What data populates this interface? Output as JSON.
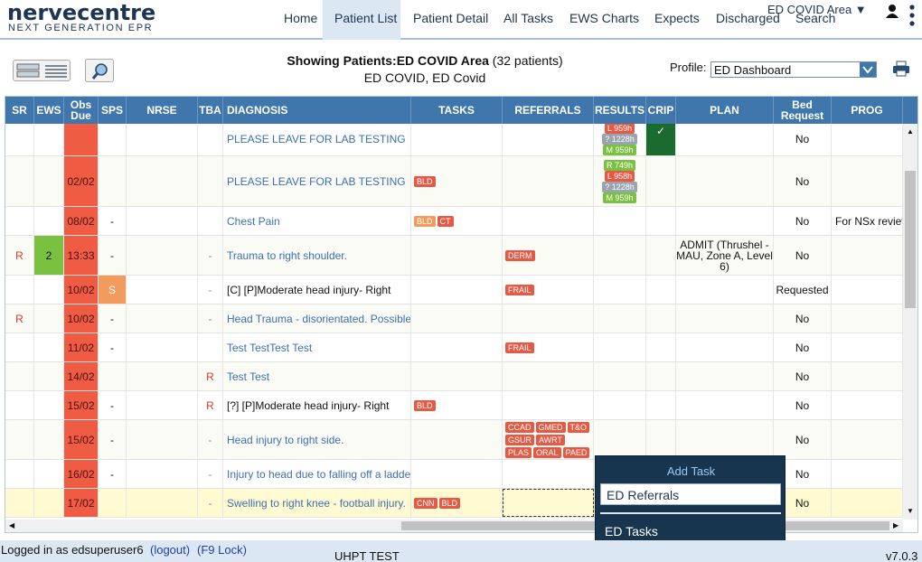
{
  "brand": {
    "name": "nervecentre",
    "tagline": "NEXT GENERATION EPR"
  },
  "nav": [
    "Home",
    "Patient List",
    "Patient Detail",
    "All Tasks",
    "EWS Charts",
    "Expects",
    "Discharged",
    "Search"
  ],
  "area": "ED COVID Area ▼",
  "header": {
    "showing_label": "Showing Patients:",
    "area_name": "ED COVID Area",
    "count": "(32 patients)",
    "subtitle": "ED COVID, ED Covid"
  },
  "profile": {
    "label": "Profile:",
    "value": "ED Dashboard"
  },
  "columns": [
    "SR",
    "EWS",
    "Obs Due",
    "SPS",
    "NRSE",
    "TBA",
    "DIAGNOSIS",
    "TASKS",
    "REFERRALS",
    "RESULTS",
    "CRIP",
    "PLAN",
    "Bed Request",
    "PROG"
  ],
  "rows": [
    {
      "sr": "",
      "ews": "",
      "obs": "",
      "sps": "",
      "tba": "",
      "diag": "PLEASE LEAVE FOR LAB TESTING",
      "tasks": [],
      "refs": [],
      "results": [
        "L 959h",
        "? 1228h",
        "M 959h"
      ],
      "crip": "✓",
      "plan": "",
      "bed": "No",
      "prog": ""
    },
    {
      "sr": "",
      "ews": "",
      "obs": "02/02",
      "sps": "",
      "tba": "",
      "diag": "PLEASE LEAVE FOR LAB TESTING",
      "tasks": [
        "BLD"
      ],
      "refs": [],
      "results": [
        "R 749h",
        "L 958h",
        "? 1228h",
        "M 959h"
      ],
      "crip": "",
      "plan": "",
      "bed": "No",
      "prog": ""
    },
    {
      "sr": "",
      "ews": "",
      "obs": "08/02",
      "sps": "-",
      "tba": "",
      "diag": "Chest Pain",
      "tasks": [
        "BLD",
        "CT"
      ],
      "refs": [],
      "results": [],
      "crip": "",
      "plan": "",
      "bed": "No",
      "prog": "For NSx review"
    },
    {
      "sr": "R",
      "ews": "2",
      "obs": "13:33",
      "sps": "-",
      "tba": "-",
      "diag": "Trauma to right shoulder.",
      "tasks": [],
      "refs": [
        "DERM"
      ],
      "results": [],
      "crip": "",
      "plan": "ADMIT (Thrushel - MAU, Zone A, Level 6)",
      "bed": "No",
      "prog": ""
    },
    {
      "sr": "",
      "ews": "",
      "obs": "10/02",
      "sps": "S",
      "tba": "-",
      "diag": "[C] [P]Moderate head injury- Right",
      "tasks": [],
      "refs": [
        "FRAIL"
      ],
      "results": [],
      "crip": "",
      "plan": "",
      "bed": "Requested",
      "prog": ""
    },
    {
      "sr": "R",
      "ews": "",
      "obs": "10/02",
      "sps": "-",
      "tba": "-",
      "diag": "Head Trauma - disorientated. Possible fracture",
      "tasks": [],
      "refs": [],
      "results": [],
      "crip": "",
      "plan": "",
      "bed": "No",
      "prog": ""
    },
    {
      "sr": "",
      "ews": "",
      "obs": "11/02",
      "sps": "-",
      "tba": "",
      "diag": "Test TestTest Test",
      "tasks": [],
      "refs": [
        "FRAIL"
      ],
      "results": [],
      "crip": "",
      "plan": "",
      "bed": "No",
      "prog": ""
    },
    {
      "sr": "",
      "ews": "",
      "obs": "14/02",
      "sps": "",
      "tba": "R",
      "diag": "Test Test",
      "tasks": [],
      "refs": [],
      "results": [],
      "crip": "",
      "plan": "",
      "bed": "No",
      "prog": ""
    },
    {
      "sr": "",
      "ews": "",
      "obs": "15/02",
      "sps": "-",
      "tba": "R",
      "diag": "[?] [P]Moderate head injury- Right",
      "tasks": [
        "BLD"
      ],
      "refs": [],
      "results": [],
      "crip": "",
      "plan": "",
      "bed": "No",
      "prog": ""
    },
    {
      "sr": "",
      "ews": "",
      "obs": "15/02",
      "sps": "-",
      "tba": "-",
      "diag": "Head injury to right side.",
      "tasks": [],
      "refs": [
        "CCAD",
        "GMED",
        "T&O",
        "GSUR",
        "AWRT",
        "PLAS",
        "ORAL",
        "PAED"
      ],
      "results": [],
      "crip": "",
      "plan": "",
      "bed": "No",
      "prog": ""
    },
    {
      "sr": "",
      "ews": "",
      "obs": "16/02",
      "sps": "-",
      "tba": "-",
      "diag": "Injury to head due to falling off a ladder.",
      "tasks": [],
      "refs": [],
      "results": [],
      "crip": "",
      "plan": "",
      "bed": "No",
      "prog": ""
    },
    {
      "sr": "",
      "ews": "",
      "obs": "17/02",
      "sps": "",
      "tba": "-",
      "diag": "Swelling to right knee - football injury.",
      "tasks": [
        "CNN",
        "BLD"
      ],
      "refs": [],
      "results": [],
      "crip": "",
      "plan": "",
      "bed": "No",
      "prog": ""
    }
  ],
  "popup": {
    "title": "Add Task",
    "item1": "ED Referrals",
    "item2": "ED Tasks"
  },
  "footer": {
    "login": "Logged in as edsuperuser6",
    "logout": "(logout)",
    "f9": "(F9 Lock)",
    "site": "UHPT TEST",
    "version": "v7.0.3"
  },
  "colors": {
    "header_blue": "#3f77ad",
    "obs_red": "#ef5b43",
    "ews_green": "#7ac142",
    "sps_orange": "#f29b5c",
    "crip_green": "#1b6b2e",
    "tag_red": "#e65a45",
    "tag_orange": "#f29b5c",
    "res_red": "#e65a45",
    "res_green": "#7ac142",
    "res_grey": "#9aa4ae",
    "popup_bg": "#18354f",
    "highlight_row": "#fffad2"
  },
  "icons": {
    "user": "user-icon",
    "menu": "kebab-menu-icon",
    "list": "list-view-icon",
    "search": "search-icon",
    "print": "printer-icon"
  }
}
